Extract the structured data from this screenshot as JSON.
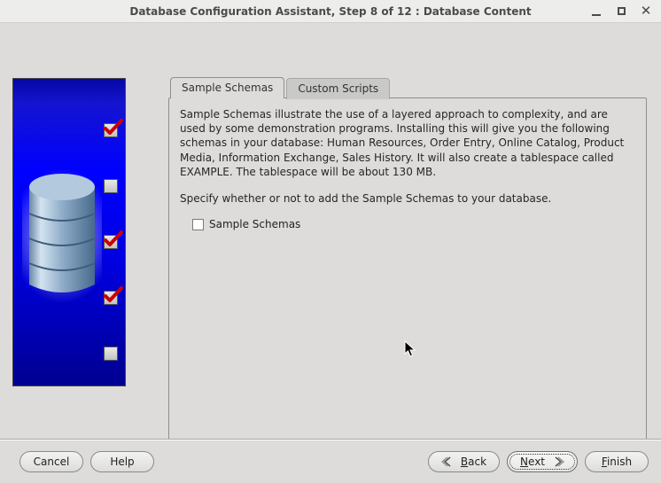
{
  "window": {
    "title": "Database Configuration Assistant, Step 8 of 12 : Database Content"
  },
  "tabs": {
    "sample": "Sample Schemas",
    "custom": "Custom Scripts"
  },
  "panel": {
    "para1": "Sample Schemas illustrate the use of a layered approach to complexity, and are used by some demonstration programs. Installing this will give you the following schemas in your database: Human Resources, Order Entry, Online Catalog, Product Media, Information Exchange, Sales History. It will also create a tablespace called EXAMPLE. The tablespace will be about 130 MB.",
    "para2": "Specify whether or not to add the Sample Schemas to your database.",
    "checkbox_label": "Sample Schemas",
    "checkbox_checked": false
  },
  "buttons": {
    "cancel": "Cancel",
    "help": "Help",
    "back": "Back",
    "next": "Next",
    "finish": "Finish"
  }
}
